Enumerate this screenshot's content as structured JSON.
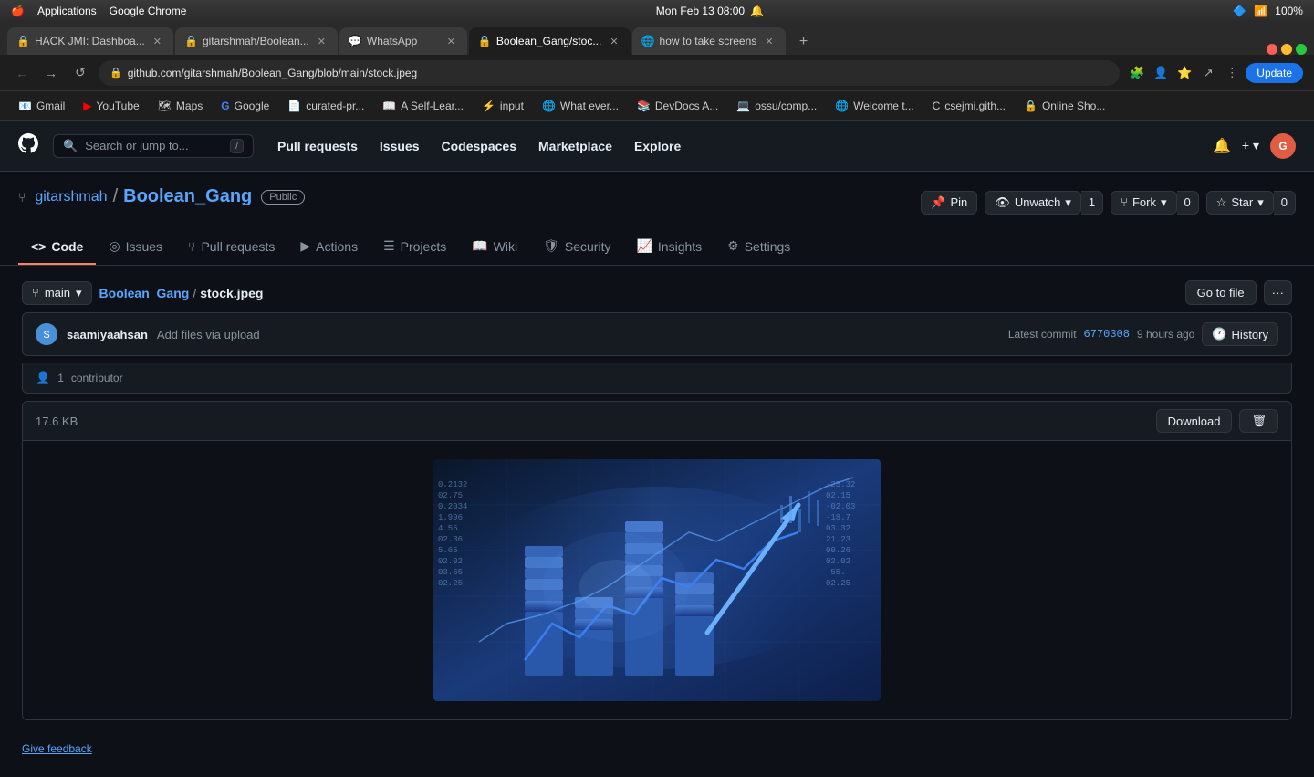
{
  "os": {
    "apple": "🍎",
    "time": "Mon Feb 13  08:00",
    "battery": "100%",
    "apps": [
      "Applications",
      "Google Chrome"
    ]
  },
  "tabs": [
    {
      "id": "tab1",
      "favicon": "🔒",
      "title": "HACK JMI: Dashboa...",
      "active": false,
      "closeable": true
    },
    {
      "id": "tab2",
      "favicon": "🔒",
      "title": "gitarshmah/Boolean...",
      "active": false,
      "closeable": true
    },
    {
      "id": "tab3",
      "favicon": "💬",
      "title": "WhatsApp",
      "active": false,
      "closeable": true
    },
    {
      "id": "tab4",
      "favicon": "🔒",
      "title": "Boolean_Gang/stoc...",
      "active": true,
      "closeable": true
    },
    {
      "id": "tab5",
      "favicon": "🌐",
      "title": "how to take screens",
      "active": false,
      "closeable": true
    }
  ],
  "addressbar": {
    "url": "github.com/gitarshmah/Boolean_Gang/blob/main/stock.jpeg",
    "update_label": "Update"
  },
  "bookmarks": [
    {
      "icon": "📧",
      "label": "Gmail"
    },
    {
      "icon": "▶",
      "label": "YouTube",
      "color": "red"
    },
    {
      "icon": "🗺",
      "label": "Maps"
    },
    {
      "icon": "G",
      "label": "Google"
    },
    {
      "icon": "📄",
      "label": "curated-pr..."
    },
    {
      "icon": "📖",
      "label": "A Self-Lear..."
    },
    {
      "icon": "⚡",
      "label": "input"
    },
    {
      "icon": "🌐",
      "label": "What ever..."
    },
    {
      "icon": "📚",
      "label": "DevDocs A..."
    },
    {
      "icon": "💻",
      "label": "ossu/comp..."
    },
    {
      "icon": "🌐",
      "label": "Welcome t..."
    },
    {
      "icon": "C",
      "label": "csejmi.gith..."
    },
    {
      "icon": "🔒",
      "label": "Online Sho..."
    }
  ],
  "github": {
    "logo": "⬡",
    "search_placeholder": "Search or jump to...",
    "search_shortcut": "/",
    "nav": [
      "Pull requests",
      "Issues",
      "Codespaces",
      "Marketplace",
      "Explore"
    ],
    "notifications_icon": "🔔",
    "plus_icon": "+",
    "repo": {
      "owner": "gitarshmah",
      "name": "Boolean_Gang",
      "visibility": "Public",
      "actions": {
        "pin": {
          "icon": "📌",
          "label": "Pin"
        },
        "unwatch": {
          "icon": "👁",
          "label": "Unwatch",
          "count": "1"
        },
        "fork": {
          "icon": "⑂",
          "label": "Fork",
          "count": "0"
        },
        "star": {
          "icon": "☆",
          "label": "Star",
          "count": "0"
        }
      }
    },
    "nav_tabs": [
      {
        "id": "code",
        "icon": "<>",
        "label": "Code",
        "active": true
      },
      {
        "id": "issues",
        "icon": "◎",
        "label": "Issues",
        "active": false
      },
      {
        "id": "pull-requests",
        "icon": "⑂",
        "label": "Pull requests",
        "active": false
      },
      {
        "id": "actions",
        "icon": "▶",
        "label": "Actions",
        "active": false
      },
      {
        "id": "projects",
        "icon": "☰",
        "label": "Projects",
        "active": false
      },
      {
        "id": "wiki",
        "icon": "📖",
        "label": "Wiki",
        "active": false
      },
      {
        "id": "security",
        "icon": "🛡",
        "label": "Security",
        "active": false
      },
      {
        "id": "insights",
        "icon": "📈",
        "label": "Insights",
        "active": false
      },
      {
        "id": "settings",
        "icon": "⚙",
        "label": "Settings",
        "active": false
      }
    ],
    "file": {
      "branch": "main",
      "repo_link": "Boolean_Gang",
      "filename": "stock.jpeg",
      "go_to_file": "Go to file",
      "more_options": "···",
      "commit": {
        "author_avatar": "S",
        "author": "saamiyaahsan",
        "message": "Add files via upload",
        "latest_commit_label": "Latest commit",
        "sha": "6770308",
        "time": "9 hours ago",
        "history_label": "History"
      },
      "contributors": {
        "icon": "👤",
        "count": "1",
        "label": "contributor"
      },
      "size": "17.6 KB",
      "download_label": "Download",
      "delete_icon": "🗑"
    },
    "feedback": "Give feedback"
  }
}
